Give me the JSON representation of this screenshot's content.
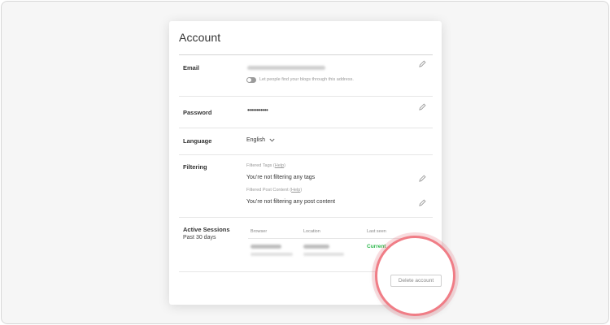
{
  "card": {
    "title": "Account"
  },
  "email": {
    "label": "Email",
    "find_toggle_text": "Let people find your blogs through this address."
  },
  "password": {
    "label": "Password",
    "masked_value": "•••••••••••"
  },
  "language": {
    "label": "Language",
    "value": "English"
  },
  "filtering": {
    "label": "Filtering",
    "tags": {
      "heading": "Filtered Tags",
      "help": "Help",
      "status": "You’re not filtering any tags"
    },
    "post_content": {
      "heading": "Filtered Post Content",
      "help": "Help",
      "status": "You’re not filtering any post content"
    }
  },
  "sessions": {
    "label": "Active Sessions",
    "sublabel": "Past 30 days",
    "columns": [
      "Browser",
      "Location",
      "Last seen"
    ],
    "current_label": "Current"
  },
  "delete_account": {
    "label": "Delete account"
  },
  "colors": {
    "current_green": "#2db84c",
    "spotlight_ring": "#f07d86"
  },
  "icons": {
    "edit": "pencil-icon",
    "language_select": "chevron-down-icon",
    "toggle": "toggle-switch"
  }
}
